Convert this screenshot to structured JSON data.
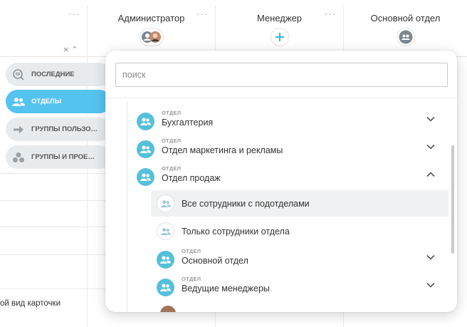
{
  "columns": [
    {
      "title": "",
      "dots": "···"
    },
    {
      "title": "Администратор",
      "dots": "···"
    },
    {
      "title": "Менеджер",
      "dots": "···"
    },
    {
      "title": "Основной отдел",
      "dots": ""
    }
  ],
  "sort_icon": "⨯ ⌃",
  "bottom_text": "ой вид карточки",
  "sidebar": {
    "items": [
      {
        "label": "ПОСЛЕДНИЕ",
        "icon": "recent-search-icon",
        "active": false
      },
      {
        "label": "ОТДЕЛЫ",
        "icon": "people-icon",
        "active": true
      },
      {
        "label": "ГРУППЫ ПОЛЬЗО…",
        "icon": "arrow-right-icon",
        "active": false
      },
      {
        "label": "ГРУППЫ И ПРОЕ…",
        "icon": "group-dots-icon",
        "active": false
      }
    ]
  },
  "popup": {
    "search_placeholder": "поиск",
    "items": [
      {
        "type": "ОТДЕЛ",
        "name": "Бухгалтерия",
        "chevron": "down"
      },
      {
        "type": "ОТДЕЛ",
        "name": "Отдел маркетинга и рекламы",
        "chevron": "down"
      },
      {
        "type": "ОТДЕЛ",
        "name": "Отдел продаж",
        "chevron": "up"
      }
    ],
    "sub_items": [
      {
        "name": "Все сотрудники с подотделами",
        "highlighted": true
      },
      {
        "name": "Только сотрудники отдела",
        "highlighted": false
      }
    ],
    "items_after": [
      {
        "type": "ОТДЕЛ",
        "name": "Основной отдел",
        "chevron": "down"
      },
      {
        "type": "ОТДЕЛ",
        "name": "Ведущие менеджеры",
        "chevron": "down"
      }
    ]
  },
  "colors": {
    "accent": "#55c3ef",
    "dept_icon": "#55c0db",
    "plus": "#2fb7e0"
  }
}
